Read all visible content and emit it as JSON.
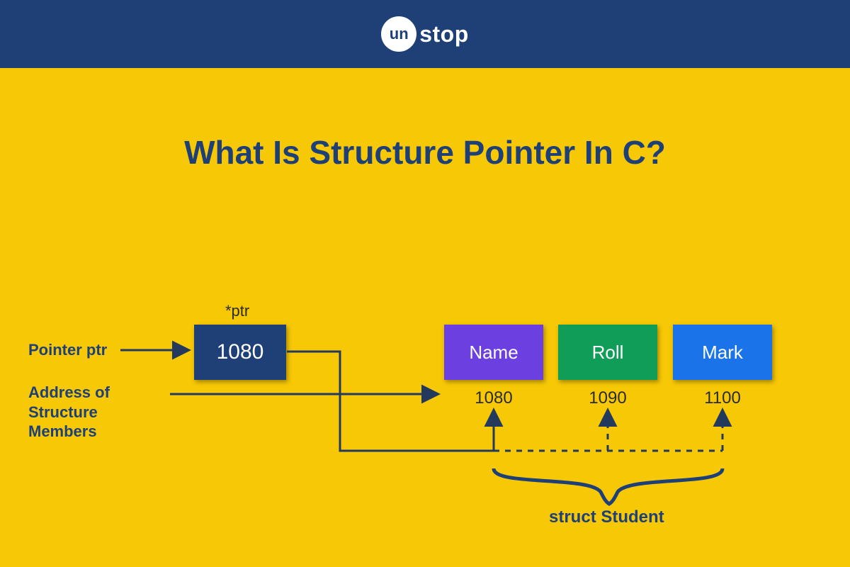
{
  "brand": {
    "circle": "un",
    "rest": "stop"
  },
  "title": "What Is Structure Pointer In C?",
  "pointer": {
    "label": "*ptr",
    "value": "1080"
  },
  "leftLabels": {
    "pointerArrow": "Pointer ptr",
    "addressArrow": "Address of\nStructure\nMembers"
  },
  "members": [
    {
      "name": "Name",
      "address": "1080",
      "color": "#6b3fe0"
    },
    {
      "name": "Roll",
      "address": "1090",
      "color": "#0f9d58"
    },
    {
      "name": "Mark",
      "address": "1100",
      "color": "#1a73e8"
    }
  ],
  "structLabel": "struct Student"
}
